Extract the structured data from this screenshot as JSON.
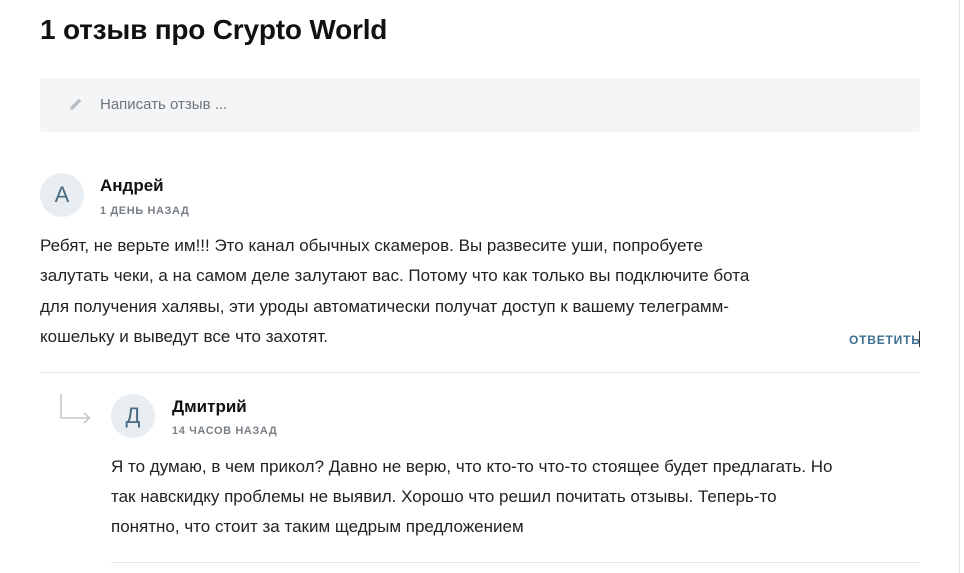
{
  "page": {
    "title": "1 отзыв про Crypto World"
  },
  "write_review": {
    "placeholder": "Написать отзыв ...",
    "icon": "pencil-icon"
  },
  "review": {
    "avatar_letter": "А",
    "author": "Андрей",
    "date": "1 ДЕНЬ НАЗАД",
    "text_lines": [
      "Ребят, не верьте им!!! Это канал обычных скамеров. Вы развесите уши, попробуете",
      "залутать чеки, а на самом деле залутают вас. Потому что как только вы подключите бота",
      "для получения халявы, эти уроды автоматически получат доступ к вашему телеграмм-",
      "кошельку и выведут все что захотят."
    ],
    "reply_label": "ОТВЕТИТЬ"
  },
  "reply": {
    "avatar_letter": "Д",
    "author": "Дмитрий",
    "date": "14 ЧАСОВ НАЗАД",
    "text_lines": [
      "Я то думаю, в чем прикол? Давно не верю, что кто-то что-то стоящее будет предлагать. Но",
      "так навскидку проблемы не выявил. Хорошо что решил почитать отзывы. Теперь-то",
      "понятно, что стоит за таким щедрым предложением"
    ]
  },
  "colors": {
    "accent": "#3c6f8f",
    "box_bg": "#f4f5f6",
    "avatar_bg": "#e8edf1"
  }
}
